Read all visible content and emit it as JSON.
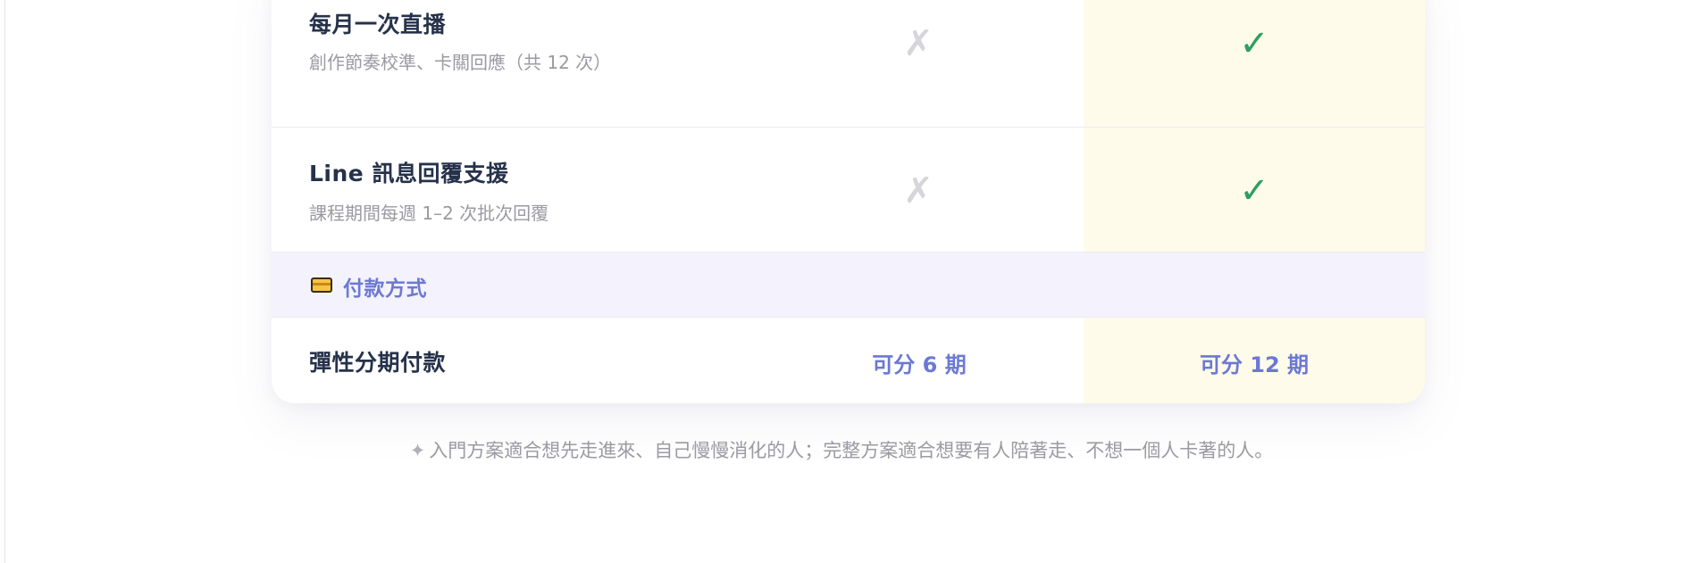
{
  "features": [
    {
      "title": "每月一次直播",
      "description": "創作節奏校準、卡關回應（共 12 次）",
      "basic": "✗",
      "full": "✓"
    },
    {
      "title": "Line 訊息回覆支援",
      "description": "課程期間每週 1–2 次批次回覆",
      "basic": "✗",
      "full": "✓"
    }
  ],
  "payment_section": {
    "icon": "credit-card-icon",
    "label": "付款方式"
  },
  "payment_row": {
    "title": "彈性分期付款",
    "basic": "可分 6 期",
    "full": "可分 12 期"
  },
  "footnote": {
    "icon": "sparkle-icon",
    "symbol": "✦",
    "text": "入門方案適合想先走進來、自己慢慢消化的人；完整方案適合想要有人陪著走、不想一個人卡著的人。"
  },
  "colors": {
    "accent": "#6b79d4",
    "check": "#2f9e62",
    "cross": "#d5d5da",
    "highlight_column": "#fffbea",
    "section_background": "#f4f2fd",
    "title_text": "#26324a",
    "muted_text": "#9a9aa2"
  }
}
